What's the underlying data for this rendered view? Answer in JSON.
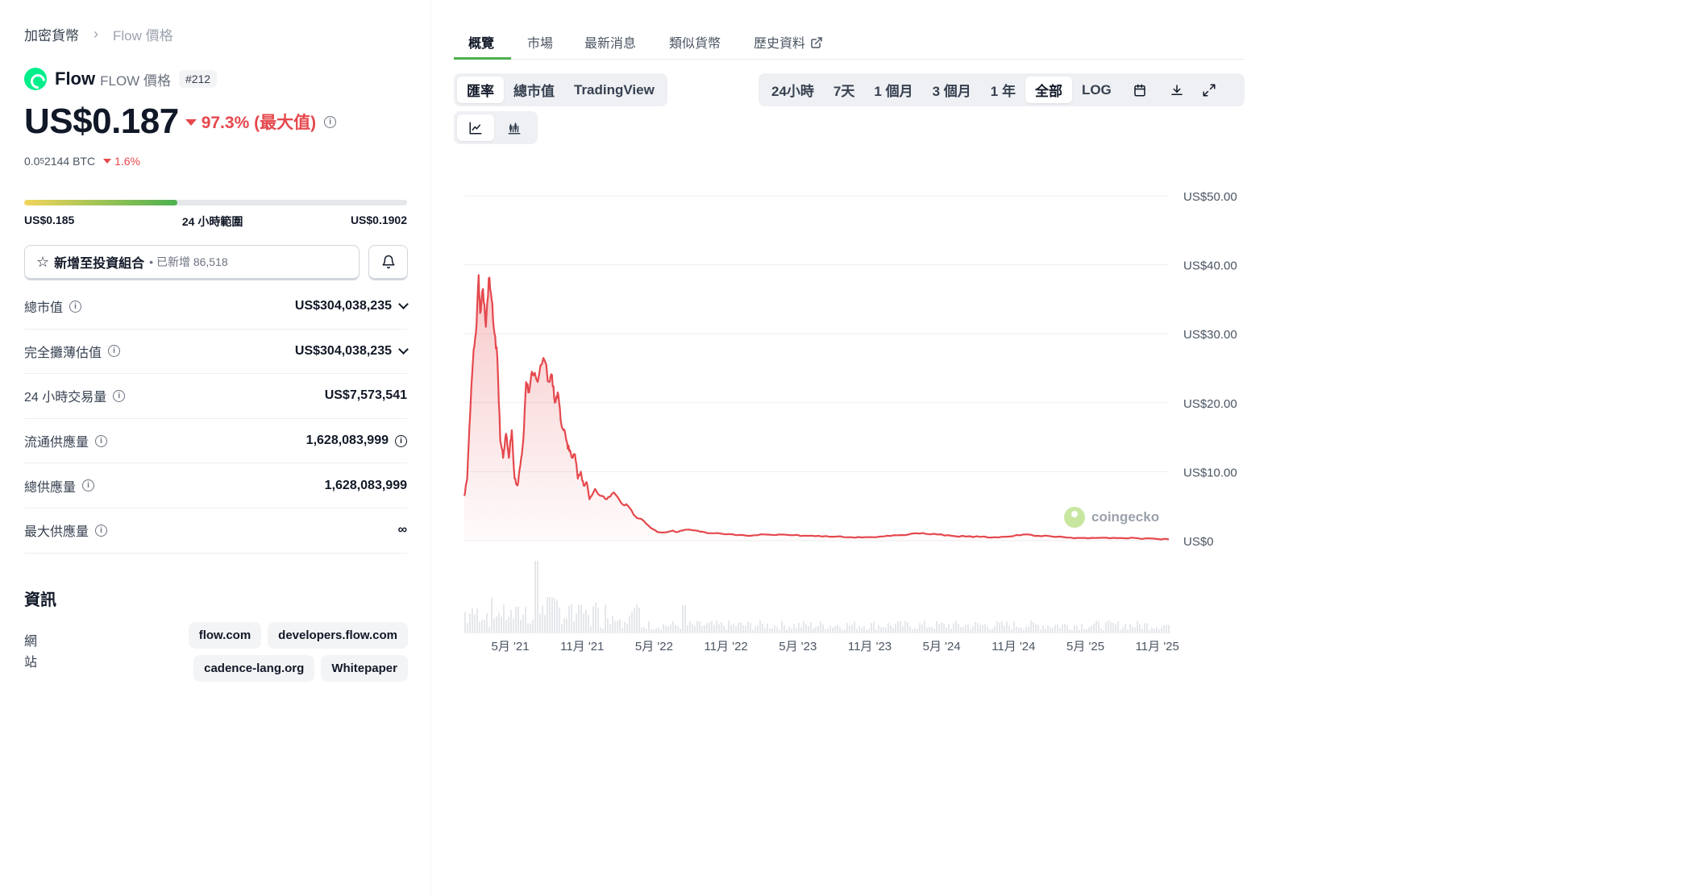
{
  "breadcrumb": {
    "root": "加密貨幣",
    "separator": "›",
    "current": "Flow 價格"
  },
  "coin": {
    "name": "Flow",
    "symbol_label": "FLOW 價格",
    "rank": "#212",
    "brand_color": "#00ef8b"
  },
  "price": {
    "value": "US$0.187",
    "change": "97.3% (最大值)",
    "change_color": "#e5484d"
  },
  "btc": {
    "prefix": "0.0",
    "sub": "5",
    "suffix": "2144 BTC",
    "change": "1.6%"
  },
  "range_24h": {
    "low": "US$0.185",
    "label": "24 小時範圍",
    "high": "US$0.1902",
    "position_fraction": 0.4
  },
  "portfolio": {
    "label": "新增至投資組合",
    "added": "• 已新增 86,518"
  },
  "stats": [
    {
      "label": "總市值",
      "value": "US$304,038,235"
    },
    {
      "label": "完全攤薄估值",
      "value": "US$304,038,235"
    },
    {
      "label": "24 小時交易量",
      "value": "US$7,573,541"
    },
    {
      "label": "流通供應量",
      "value": "1,628,083,999"
    },
    {
      "label": "總供應量",
      "value": "1,628,083,999"
    },
    {
      "label": "最大供應量",
      "value": "∞"
    }
  ],
  "info": {
    "heading": "資訊",
    "website_label": "網站",
    "links": [
      "flow.com",
      "developers.flow.com",
      "cadence-lang.org",
      "Whitepaper"
    ]
  },
  "tabs": [
    "概覽",
    "市場",
    "最新消息",
    "類似貨幣",
    "歷史資料"
  ],
  "chart_modes": [
    "匯率",
    "總市值",
    "TradingView"
  ],
  "time_ranges": [
    "24小時",
    "7天",
    "1 個月",
    "3 個月",
    "1 年",
    "全部",
    "LOG"
  ],
  "selected_range": "全部",
  "watermark": "coingecko",
  "chart_data": {
    "type": "area",
    "title": "",
    "xlabel": "",
    "ylabel": "",
    "ylim": [
      0,
      50
    ],
    "y_ticks": [
      "US$0",
      "US$10.00",
      "US$20.00",
      "US$30.00",
      "US$40.00",
      "US$50.00"
    ],
    "y_tick_values": [
      0,
      10,
      20,
      30,
      40,
      50
    ],
    "x_tick_labels": [
      "5月 '21",
      "11月 '21",
      "5月 '22",
      "11月 '22",
      "5月 '23",
      "11月 '23",
      "5月 '24",
      "11月 '24",
      "5月 '25",
      "11月 '25"
    ],
    "x_tick_values": [
      2021.33,
      2021.83,
      2022.33,
      2022.83,
      2023.33,
      2023.83,
      2024.33,
      2024.83,
      2025.33,
      2025.83
    ],
    "xlim": [
      2021.01,
      2025.91
    ],
    "grid": true,
    "line_color": "#e5484d",
    "series": [
      {
        "x": [
          2021.01,
          2021.03,
          2021.05,
          2021.07,
          2021.09,
          2021.11,
          2021.12,
          2021.14,
          2021.16,
          2021.18,
          2021.2,
          2021.22,
          2021.24,
          2021.26,
          2021.28,
          2021.3,
          2021.32,
          2021.34,
          2021.36,
          2021.38,
          2021.4,
          2021.42,
          2021.44,
          2021.46,
          2021.48,
          2021.52,
          2021.56,
          2021.6,
          2021.62,
          2021.64,
          2021.66,
          2021.68,
          2021.7,
          2021.72,
          2021.74,
          2021.76,
          2021.78,
          2021.8,
          2021.82,
          2021.84,
          2021.86,
          2021.88,
          2021.92,
          2021.96,
          2022.0,
          2022.05,
          2022.1,
          2022.15,
          2022.2,
          2022.25,
          2022.3,
          2022.35,
          2022.4,
          2022.45,
          2022.5,
          2022.55,
          2022.6,
          2022.65,
          2022.7,
          2022.8,
          2022.9,
          2023.0,
          2023.1,
          2023.2,
          2023.3,
          2023.4,
          2023.5,
          2023.6,
          2023.7,
          2023.8,
          2023.9,
          2024.0,
          2024.1,
          2024.2,
          2024.3,
          2024.4,
          2024.5,
          2024.6,
          2024.7,
          2024.8,
          2024.9,
          2025.0,
          2025.1,
          2025.2,
          2025.3,
          2025.4,
          2025.5,
          2025.6,
          2025.7,
          2025.8,
          2025.91
        ],
        "y": [
          6.5,
          9.0,
          18.0,
          26.0,
          30.0,
          38.5,
          33.0,
          36.5,
          31.0,
          38.0,
          35.0,
          30.0,
          26.5,
          14.5,
          12.0,
          15.5,
          12.0,
          16.0,
          9.0,
          8.0,
          11.0,
          14.5,
          23.0,
          21.5,
          24.5,
          23.0,
          26.5,
          23.0,
          24.0,
          20.0,
          21.5,
          17.5,
          16.0,
          14.5,
          13.0,
          12.0,
          12.5,
          9.0,
          10.0,
          8.0,
          8.5,
          6.0,
          7.5,
          6.5,
          6.0,
          7.0,
          5.5,
          5.0,
          3.5,
          3.0,
          2.0,
          1.3,
          1.2,
          1.4,
          1.3,
          1.6,
          1.5,
          1.3,
          1.1,
          1.0,
          0.8,
          0.7,
          0.9,
          0.9,
          0.8,
          0.7,
          0.6,
          0.6,
          0.5,
          0.5,
          0.6,
          0.8,
          0.9,
          1.1,
          0.9,
          0.7,
          0.6,
          0.55,
          0.5,
          0.6,
          0.9,
          0.7,
          0.6,
          0.45,
          0.4,
          0.38,
          0.35,
          0.35,
          0.33,
          0.3,
          0.19
        ]
      }
    ],
    "volume_shown": true
  }
}
